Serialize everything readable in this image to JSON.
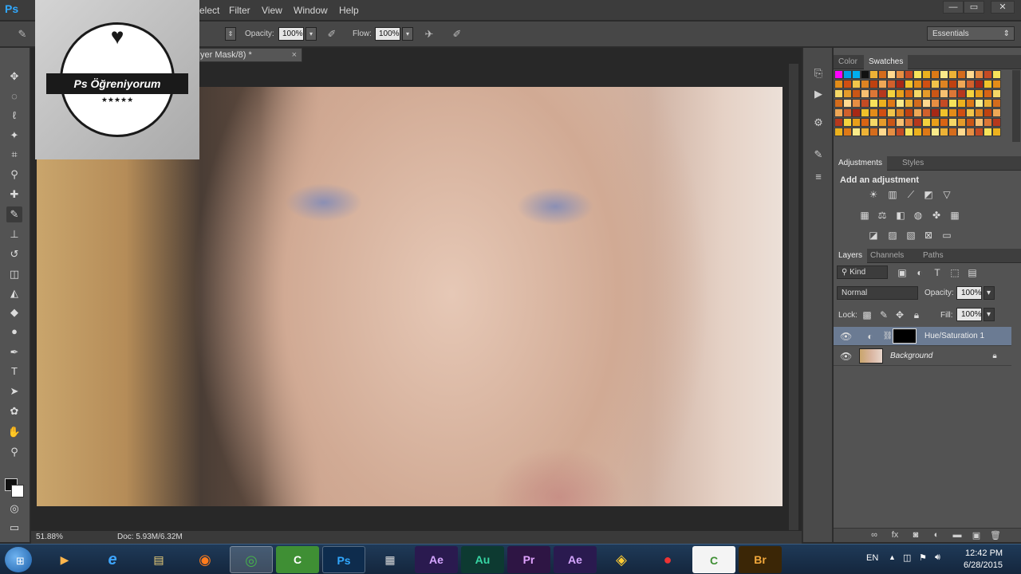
{
  "app": {
    "logo": "Ps"
  },
  "menu": [
    "elect",
    "Filter",
    "View",
    "Window",
    "Help"
  ],
  "window_controls": [
    "—",
    "▭",
    "✕"
  ],
  "options_bar": {
    "opacity_label": "Opacity:",
    "opacity_value": "100%",
    "flow_label": "Flow:",
    "flow_value": "100%",
    "workspace": "Essentials"
  },
  "document": {
    "tab_title": "yer Mask/8) *",
    "zoom": "51.88%",
    "doc_info": "Doc: 5.93M/6.32M"
  },
  "watermark": {
    "brand": "Ps Öğreniyorum",
    "stars": "★★★★★"
  },
  "panels": {
    "color_tabs": [
      "Color",
      "Swatches"
    ],
    "adjust_tabs": [
      "Adjustments",
      "Styles"
    ],
    "adjust_title": "Add an adjustment",
    "layer_tabs": [
      "Layers",
      "Channels",
      "Paths"
    ],
    "kind_filter": "Kind",
    "blend_mode": "Normal",
    "opacity_label": "Opacity:",
    "opacity_value": "100%",
    "lock_label": "Lock:",
    "fill_label": "Fill:",
    "fill_value": "100%",
    "layers": [
      {
        "name": "Hue/Saturation 1",
        "selected": true
      },
      {
        "name": "Background",
        "selected": false
      }
    ]
  },
  "taskbar": {
    "apps": [
      "▶",
      "e",
      "▤",
      "◉",
      "◎",
      "C",
      "Ps",
      "▦",
      "Ae",
      "Au",
      "Pr",
      "Ae",
      "◈",
      "●",
      "C",
      "Br"
    ],
    "language": "EN",
    "time": "12:42 PM",
    "date": "6/28/2015"
  },
  "colors": {
    "accent": "#31a8ff",
    "selected_layer": "#6b7b93",
    "panel_bg": "#535353"
  }
}
